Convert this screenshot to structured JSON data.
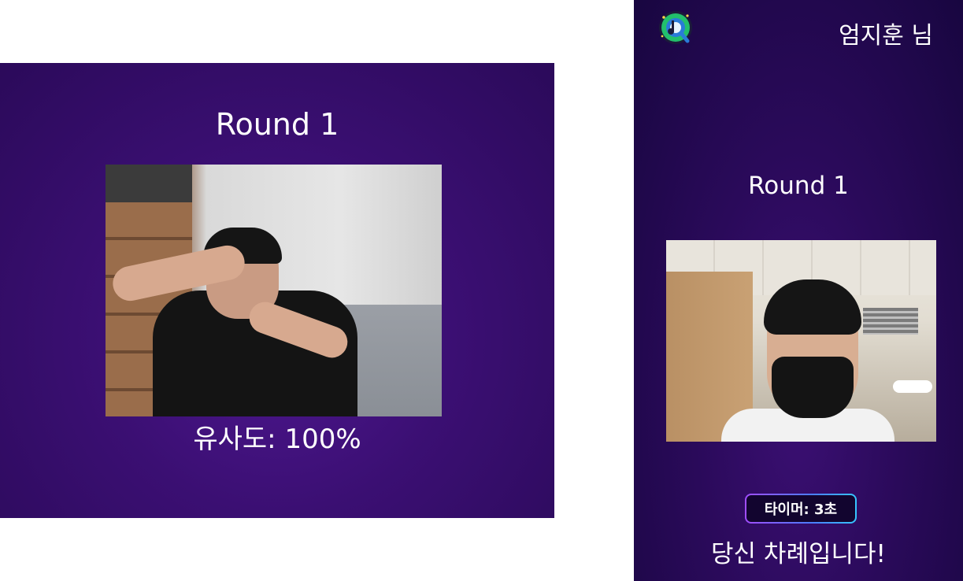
{
  "left_panel": {
    "round_label": "Round 1",
    "similarity_text": "유사도: 100%"
  },
  "right_panel": {
    "logo_icon": "music-q-logo-icon",
    "user_name": "엄지훈 님",
    "round_label": "Round 1",
    "timer_text": "타이머: 3초",
    "turn_message": "당신 차례입니다!"
  },
  "colors": {
    "panel_bg": "#3b0f73",
    "timer_border_start": "#a14dff",
    "timer_border_end": "#36c6ff",
    "text": "#ffffff"
  }
}
